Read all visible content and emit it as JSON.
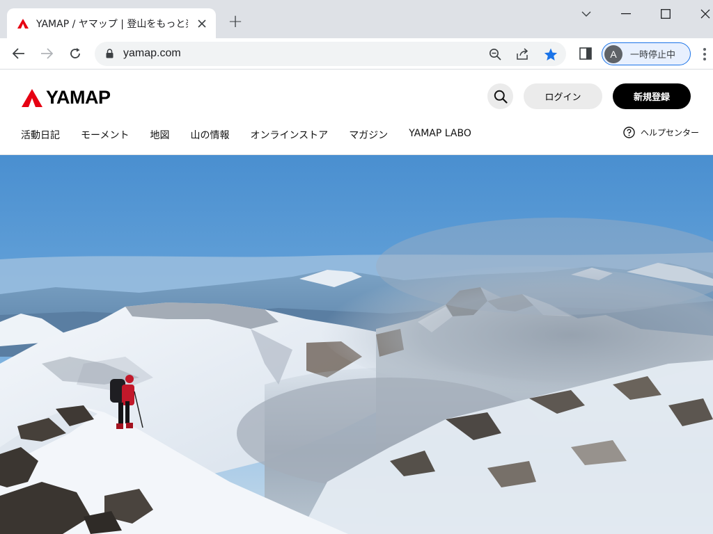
{
  "browser": {
    "tab": {
      "title": "YAMAP / ヤマップ | 登山をもっと楽し",
      "close_icon": "close-icon"
    },
    "new_tab_label": "+",
    "url": "yamap.com",
    "profile": {
      "initial": "A",
      "label": "一時停止中"
    },
    "accent": "#1a73e8"
  },
  "site": {
    "logo_text": "YAMAP",
    "brand_color": "#e60012",
    "header": {
      "login_label": "ログイン",
      "signup_label": "新規登録"
    },
    "nav": [
      {
        "label": "活動日記"
      },
      {
        "label": "モーメント"
      },
      {
        "label": "地図"
      },
      {
        "label": "山の情報"
      },
      {
        "label": "オンラインストア"
      },
      {
        "label": "マガジン"
      },
      {
        "label": "YAMAP LABO"
      }
    ],
    "help_label": "ヘルプセンター"
  }
}
